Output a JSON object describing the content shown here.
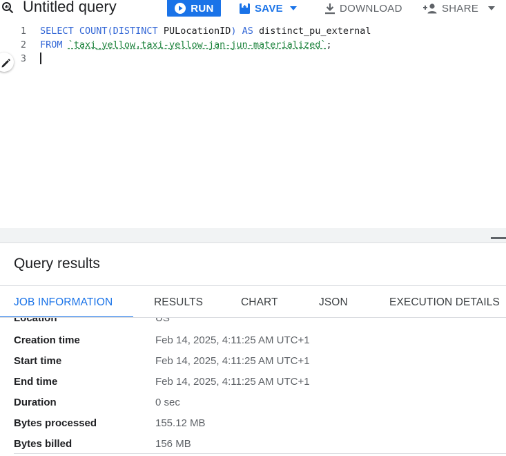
{
  "toolbar": {
    "icon": "query-icon",
    "title": "Untitled query",
    "run_label": "RUN",
    "save_label": "SAVE",
    "download_label": "DOWNLOAD",
    "share_label": "SHARE"
  },
  "editor": {
    "line_numbers": [
      "1",
      "2",
      "3"
    ],
    "line1": {
      "kw1": "SELECT COUNT(DISTINCT ",
      "ident": "PULocationID",
      "kw2": ") AS ",
      "alias": "distinct_pu_external"
    },
    "line2": {
      "kw": "FROM ",
      "table": "`taxi_yellow.taxi-yellow-jan-jun-materialized`",
      "end": ";"
    }
  },
  "results": {
    "title": "Query results",
    "tabs": [
      "JOB INFORMATION",
      "RESULTS",
      "CHART",
      "JSON",
      "EXECUTION DETAILS"
    ],
    "active_tab": "JOB INFORMATION",
    "job_info": [
      {
        "key": "Location",
        "value": "US"
      },
      {
        "key": "Creation time",
        "value": "Feb 14, 2025, 4:11:25 AM UTC+1"
      },
      {
        "key": "Start time",
        "value": "Feb 14, 2025, 4:11:25 AM UTC+1"
      },
      {
        "key": "End time",
        "value": "Feb 14, 2025, 4:11:25 AM UTC+1"
      },
      {
        "key": "Duration",
        "value": "0 sec"
      },
      {
        "key": "Bytes processed",
        "value": "155.12 MB"
      },
      {
        "key": "Bytes billed",
        "value": "156 MB"
      }
    ]
  },
  "colors": {
    "accent": "#1a73e8",
    "keyword": "#3367d6",
    "string": "#188038"
  }
}
